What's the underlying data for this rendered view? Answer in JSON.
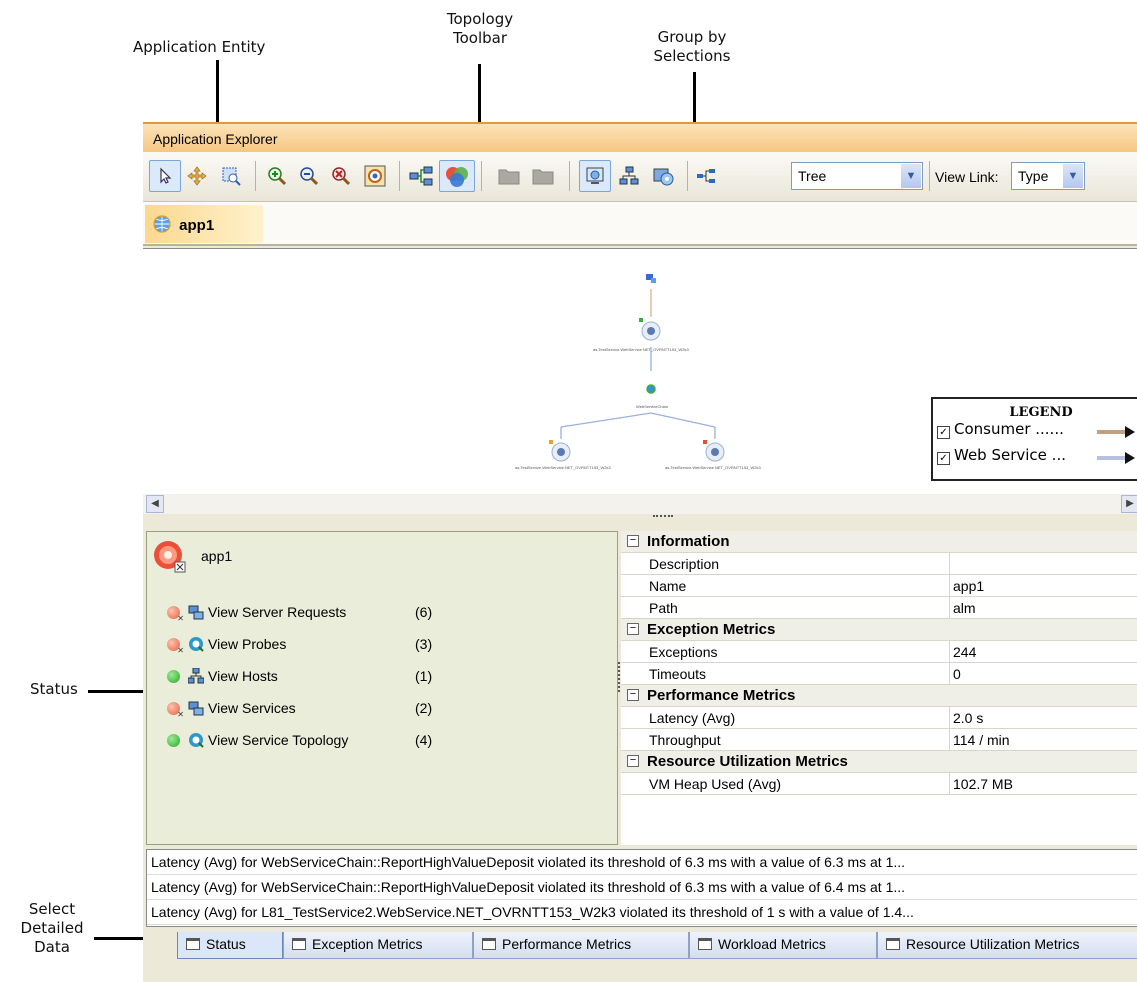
{
  "callouts": {
    "application_entity": "Application Entity",
    "topology_toolbar_1": "Topology",
    "topology_toolbar_2": "Toolbar",
    "group_by_1": "Group by",
    "group_by_2": "Selections",
    "status": "Status",
    "select_1": "Select",
    "select_2": "Detailed",
    "select_3": "Data"
  },
  "window": {
    "title": "Application Explorer"
  },
  "toolbar": {
    "buttons": [
      "select-icon",
      "pan-icon",
      "marquee-zoom-icon",
      "zoom-in-icon",
      "zoom-out-icon",
      "zoom-reset-icon",
      "fit-to-window-icon",
      "topology-map-icon",
      "group-by-icon",
      "folder-icon",
      "folder-icon",
      "host-view-icon",
      "network-icon",
      "services-icon",
      "tree-layout-icon"
    ],
    "layout_value": "Tree",
    "view_link_label": "View Link:",
    "view_link_value": "Type"
  },
  "entity_tab": {
    "label": "app1"
  },
  "legend": {
    "title": "LEGEND",
    "items": [
      {
        "label": "Consumer ......",
        "checked": true,
        "color": "#c0a080"
      },
      {
        "label": "Web Service ...",
        "checked": true,
        "color": "#b8c0e0"
      }
    ]
  },
  "status_panel": {
    "entity_name": "app1",
    "items": [
      {
        "label": "View Server Requests",
        "count": "(6)",
        "status": "error"
      },
      {
        "label": "View Probes",
        "count": "(3)",
        "status": "error"
      },
      {
        "label": "View Hosts",
        "count": "(1)",
        "status": "ok"
      },
      {
        "label": "View Services",
        "count": "(2)",
        "status": "error"
      },
      {
        "label": "View Service Topology",
        "count": "(4)",
        "status": "ok"
      }
    ]
  },
  "properties": {
    "sections": [
      {
        "title": "Information",
        "rows": [
          {
            "key": "Description",
            "value": ""
          },
          {
            "key": "Name",
            "value": "app1"
          },
          {
            "key": "Path",
            "value": "alm"
          }
        ]
      },
      {
        "title": "Exception Metrics",
        "rows": [
          {
            "key": "Exceptions",
            "value": "244"
          },
          {
            "key": "Timeouts",
            "value": "0"
          }
        ]
      },
      {
        "title": "Performance Metrics",
        "rows": [
          {
            "key": "Latency (Avg)",
            "value": "2.0 s"
          },
          {
            "key": "Throughput",
            "value": "114 / min"
          }
        ]
      },
      {
        "title": "Resource Utilization Metrics",
        "rows": [
          {
            "key": "VM Heap Used (Avg)",
            "value": "102.7 MB"
          }
        ]
      }
    ]
  },
  "alerts": [
    "Latency (Avg) for WebServiceChain::ReportHighValueDeposit violated its threshold of 6.3 ms with a value of 6.3 ms at 1...",
    "Latency (Avg) for WebServiceChain::ReportHighValueDeposit violated its threshold of 6.3 ms with a value of 6.4 ms at 1...",
    "Latency (Avg) for L81_TestService2.WebService.NET_OVRNTT153_W2k3 violated its threshold of 1 s with a value of 1.4..."
  ],
  "bottom_tabs": [
    "Status",
    "Exception Metrics",
    "Performance Metrics",
    "Workload Metrics",
    "Resource Utilization Metrics"
  ],
  "topology_nodes": [
    "as-TestService.WebService.NET_OVRNTT153_W2k3",
    "WebServiceChain"
  ]
}
